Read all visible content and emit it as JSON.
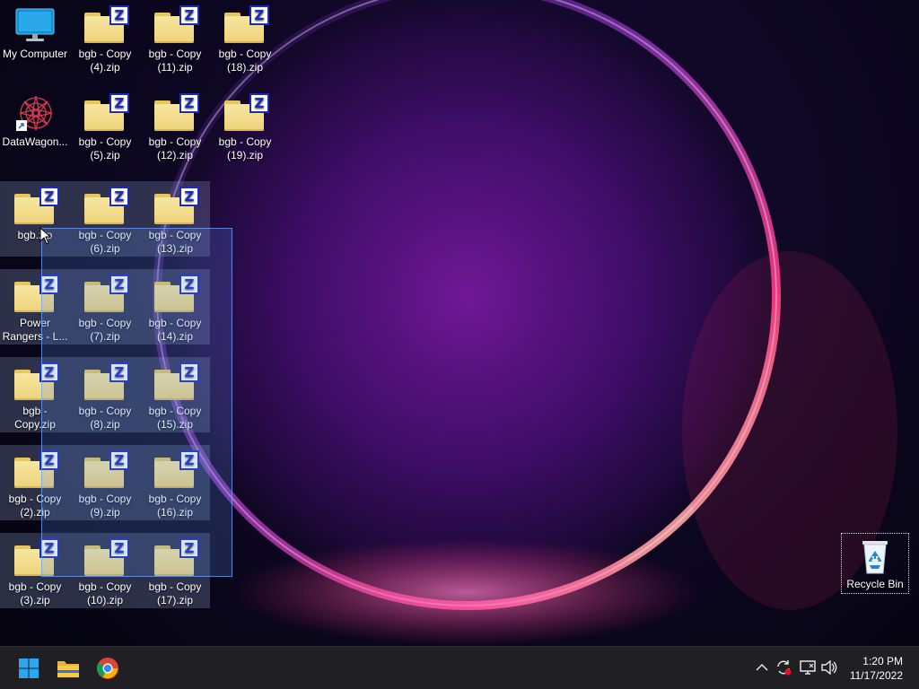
{
  "desktop": {
    "icons": [
      {
        "label": "My Computer",
        "type": "computer",
        "selected": false
      },
      {
        "label": "bgb - Copy (4).zip",
        "type": "zip",
        "selected": false
      },
      {
        "label": "bgb - Copy (11).zip",
        "type": "zip",
        "selected": false
      },
      {
        "label": "bgb - Copy (18).zip",
        "type": "zip",
        "selected": false
      },
      {
        "label": "DataWagon...",
        "type": "app",
        "selected": false
      },
      {
        "label": "bgb - Copy (5).zip",
        "type": "zip",
        "selected": false
      },
      {
        "label": "bgb - Copy (12).zip",
        "type": "zip",
        "selected": false
      },
      {
        "label": "bgb - Copy (19).zip",
        "type": "zip",
        "selected": false
      },
      {
        "label": "bgb.zip",
        "type": "zip",
        "selected": true
      },
      {
        "label": "bgb - Copy (6).zip",
        "type": "zip",
        "selected": true
      },
      {
        "label": "bgb - Copy (13).zip",
        "type": "zip",
        "selected": true
      },
      {
        "label": "Power Rangers - L...",
        "type": "zip",
        "selected": true
      },
      {
        "label": "bgb - Copy (7).zip",
        "type": "zip",
        "selected": true
      },
      {
        "label": "bgb - Copy (14).zip",
        "type": "zip",
        "selected": true
      },
      {
        "label": "bgb - Copy.zip",
        "type": "zip",
        "selected": true
      },
      {
        "label": "bgb - Copy (8).zip",
        "type": "zip",
        "selected": true
      },
      {
        "label": "bgb - Copy (15).zip",
        "type": "zip",
        "selected": true
      },
      {
        "label": "bgb - Copy (2).zip",
        "type": "zip",
        "selected": true
      },
      {
        "label": "bgb - Copy (9).zip",
        "type": "zip",
        "selected": true
      },
      {
        "label": "bgb - Copy (16).zip",
        "type": "zip",
        "selected": true
      },
      {
        "label": "bgb - Copy (3).zip",
        "type": "zip",
        "selected": true
      },
      {
        "label": "bgb - Copy (10).zip",
        "type": "zip",
        "selected": true
      },
      {
        "label": "bgb - Copy (17).zip",
        "type": "zip",
        "selected": true
      }
    ],
    "recycle_bin": {
      "label": "Recycle Bin",
      "icon": "recycle-bin-icon"
    },
    "zip_badge_letter": "Z"
  },
  "taskbar": {
    "pinned": [
      {
        "name": "start",
        "icon": "windows-logo-icon"
      },
      {
        "name": "file-explorer",
        "icon": "folder-icon"
      },
      {
        "name": "chrome",
        "icon": "chrome-icon"
      }
    ],
    "tray": {
      "chevron": "^",
      "icons": [
        "sync-icon",
        "network-icon",
        "volume-icon"
      ]
    },
    "clock": {
      "time": "1:20 PM",
      "date": "11/17/2022"
    }
  },
  "colors": {
    "taskbar_bg": "#1f1f24",
    "selection": "#8ca0c8",
    "accent_blue": "#1c2bb8",
    "start_blue": "#2aa7ef"
  }
}
